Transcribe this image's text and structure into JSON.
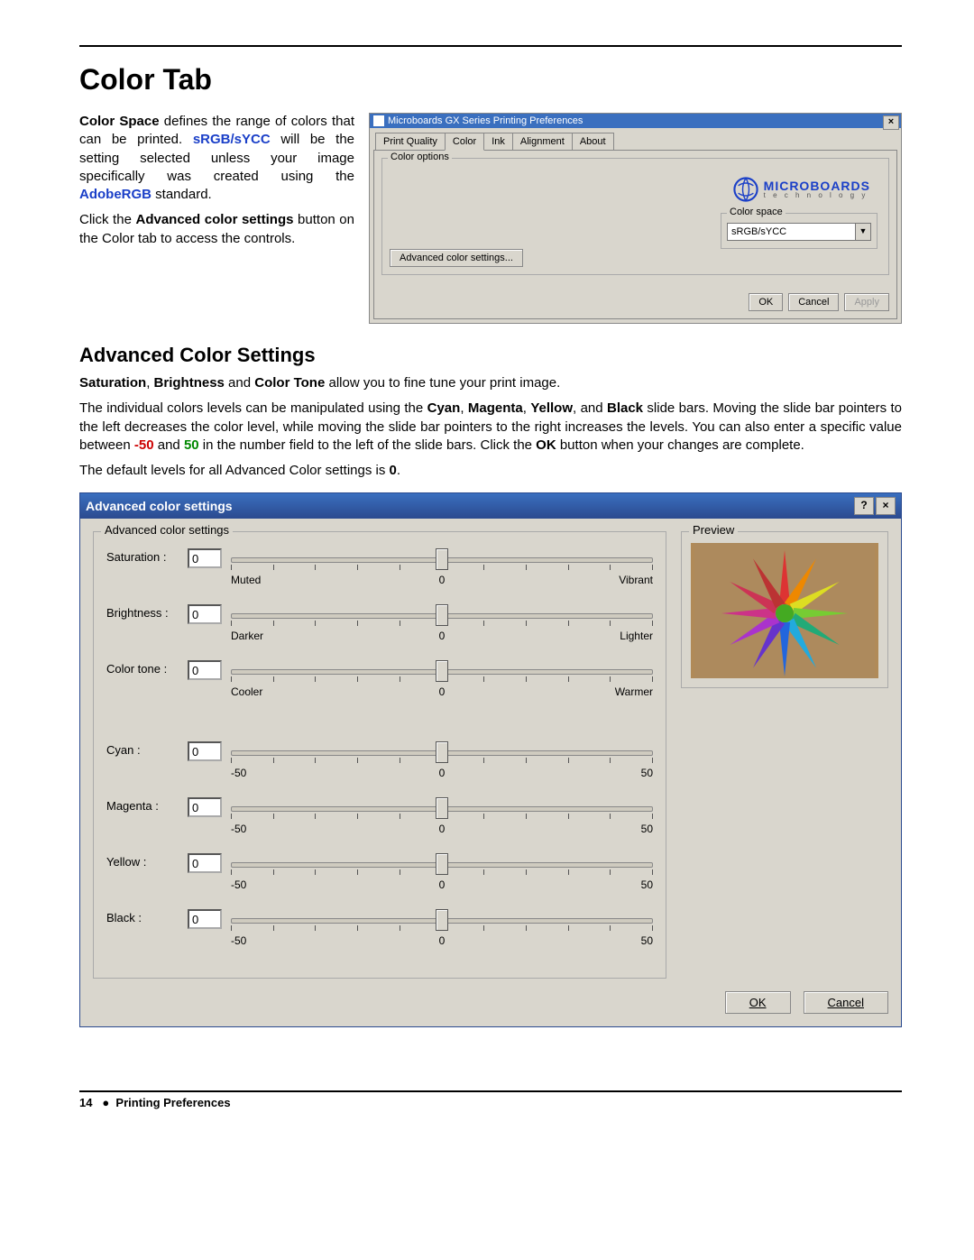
{
  "heading": "Color Tab",
  "intro": {
    "color_space_label": "Color Space",
    "p1a": " defines the range of colors that can be printed.  ",
    "srgb": "sRGB/sYCC",
    "p1b": " will be the setting selected unless your image specifically was created using the ",
    "adobe": "AdobeRGB",
    "p1c": " standard.",
    "p2a": "Click the ",
    "adv_label": "Advanced color settings",
    "p2b": " button on the Color tab to access the controls."
  },
  "prefs": {
    "title": "Microboards GX Series Printing Preferences",
    "tabs": [
      "Print Quality",
      "Color",
      "Ink",
      "Alignment",
      "About"
    ],
    "active_tab": 1,
    "group_label": "Color options",
    "logo_big": "MICROBOARDS",
    "logo_small": "t e c h n o l o g y",
    "cs_label": "Color space",
    "cs_value": "sRGB/sYCC",
    "adv_btn": "Advanced color settings...",
    "ok": "OK",
    "cancel": "Cancel",
    "apply": "Apply"
  },
  "sub_heading": "Advanced Color Settings",
  "body": {
    "p1_sat": "Saturation",
    "p1_sep1": ", ",
    "p1_bri": "Brightness",
    "p1_sep2": " and ",
    "p1_ct": "Color Tone",
    "p1_tail": " allow you to fine tune your print image.",
    "p2a": "The individual colors levels can be manipulated using the ",
    "cyan": "Cyan",
    "sep": ", ",
    "magenta": "Magenta",
    "yellow": "Yellow",
    "and": ", and ",
    "black": "Black",
    "p2b": " slide bars.  Moving the slide bar pointers to the left decreases the color level, while moving the slide bar pointers to the right increases the levels.  You can also enter a specific value between ",
    "neg50": "-50",
    "p2c": " and ",
    "pos50": "50",
    "p2d": " in the number field to the left of the slide bars.  Click the ",
    "ok": "OK",
    "p2e": " button when your changes are complete.",
    "p3a": "The default levels for all Advanced Color settings is ",
    "zero": "0",
    "p3b": "."
  },
  "adv": {
    "title": "Advanced color settings",
    "group_label": "Advanced color settings",
    "preview_label": "Preview",
    "ok": "OK",
    "cancel": "Cancel",
    "sliders_tone": [
      {
        "label": "Saturation :",
        "u": "",
        "value": "0",
        "left": "Muted",
        "mid": "0",
        "right": "Vibrant"
      },
      {
        "label": "Brightness :",
        "u": "B",
        "value": "0",
        "left": "Darker",
        "mid": "0",
        "right": "Lighter"
      },
      {
        "label": "Color tone :",
        "u": "t",
        "value": "0",
        "left": "Cooler",
        "mid": "0",
        "right": "Warmer"
      }
    ],
    "sliders_color": [
      {
        "label": "Cyan :",
        "u": "n",
        "value": "0",
        "left": "-50",
        "mid": "0",
        "right": "50"
      },
      {
        "label": "Magenta :",
        "u": "M",
        "value": "0",
        "left": "-50",
        "mid": "0",
        "right": "50"
      },
      {
        "label": "Yellow :",
        "u": "Y",
        "value": "0",
        "left": "-50",
        "mid": "0",
        "right": "50"
      },
      {
        "label": "Black :",
        "u": "k",
        "value": "0",
        "left": "-50",
        "mid": "0",
        "right": "50"
      }
    ]
  },
  "footer": {
    "page": "14",
    "bullet": "●",
    "section": "Printing Preferences"
  }
}
